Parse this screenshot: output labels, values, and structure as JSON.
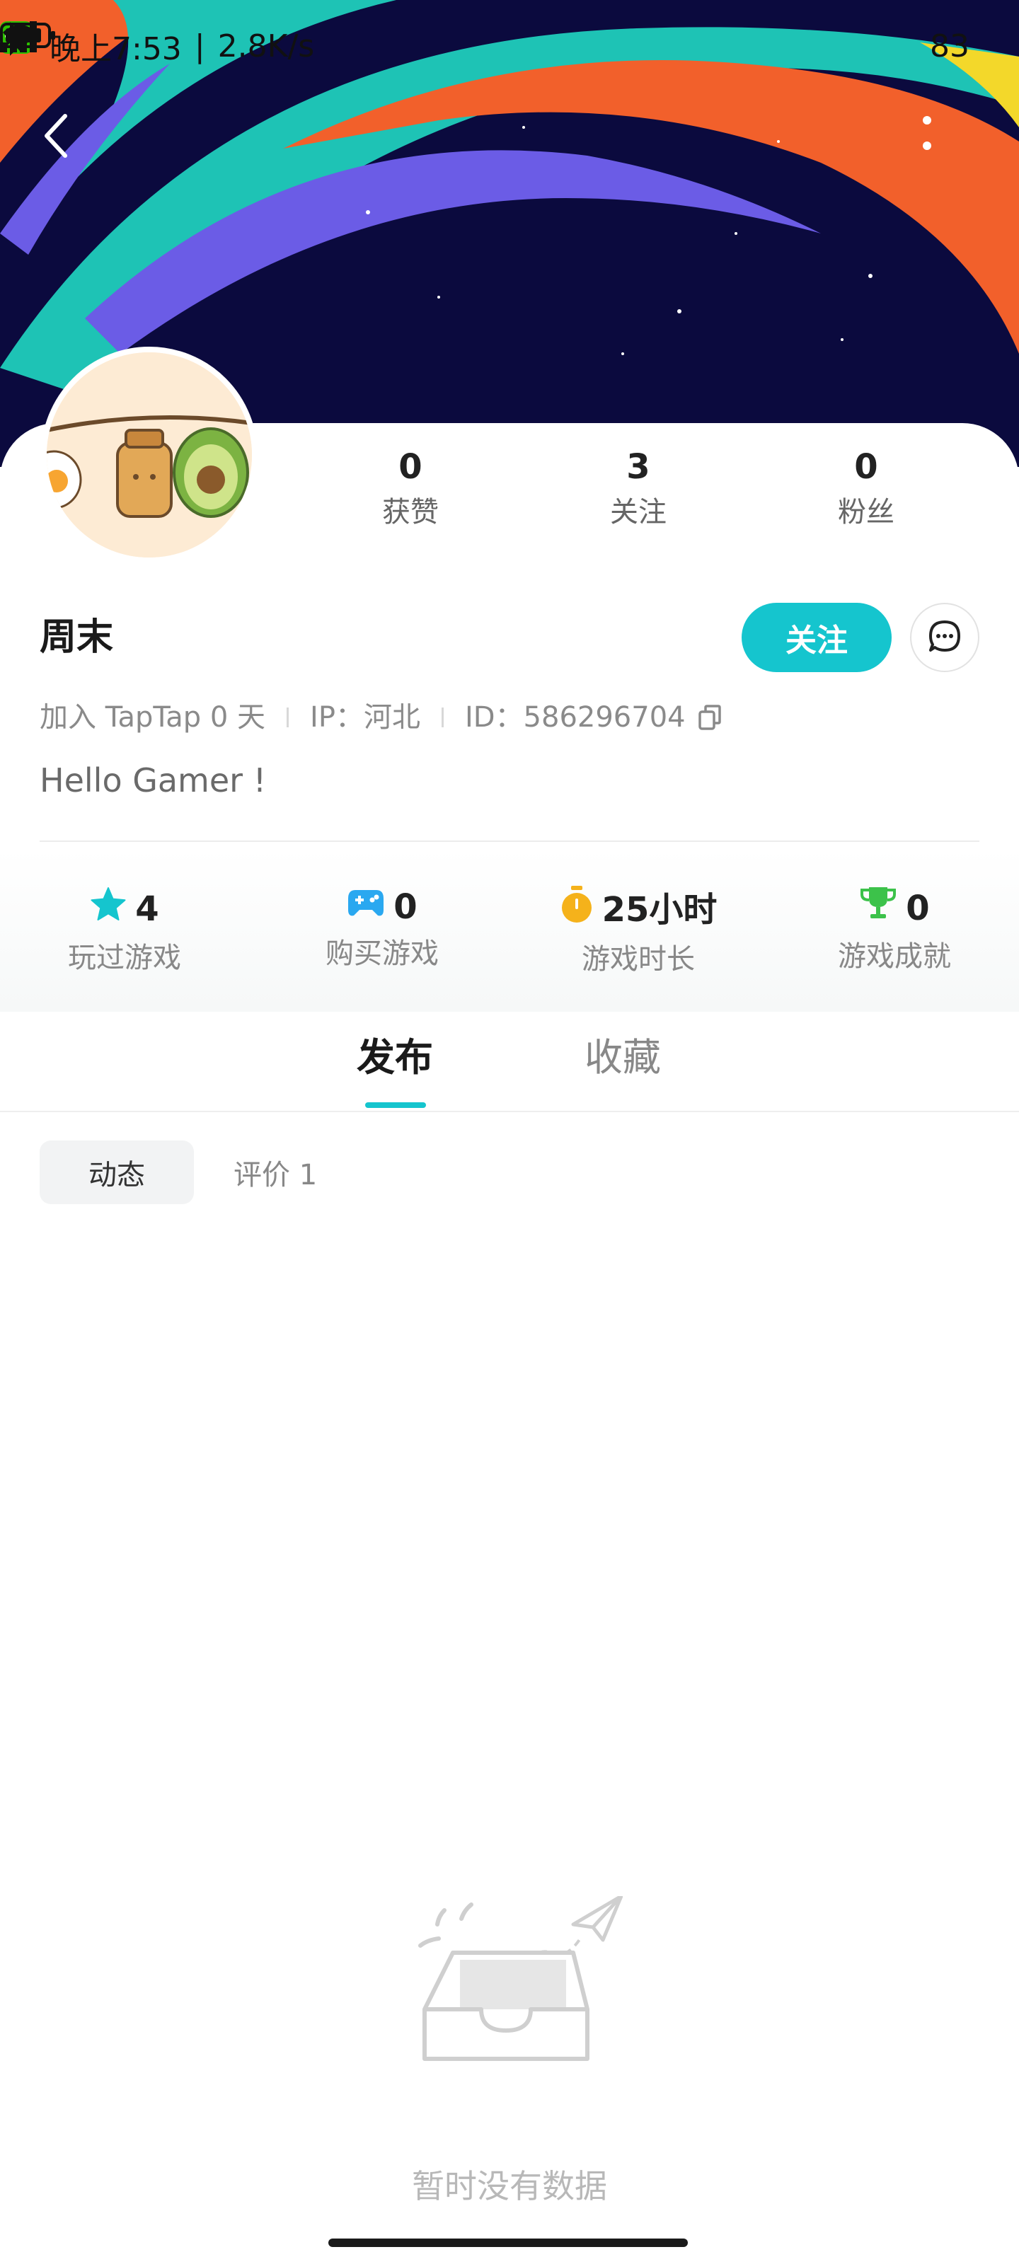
{
  "status_bar": {
    "time": "晚上7:53",
    "speed": "2.8K/s",
    "battery": "83"
  },
  "profile": {
    "name": "周末",
    "stats": [
      {
        "value": "0",
        "label": "获赞"
      },
      {
        "value": "3",
        "label": "关注"
      },
      {
        "value": "0",
        "label": "粉丝"
      }
    ],
    "follow_label": "关注",
    "meta": {
      "joined": "加入 TapTap 0 天",
      "ip": "IP：河北",
      "id": "ID：586296704"
    },
    "bio": "Hello Gamer !"
  },
  "game_stats": [
    {
      "value": "4",
      "label": "玩过游戏",
      "icon": "star-icon",
      "color": "#15c5ce"
    },
    {
      "value": "0",
      "label": "购买游戏",
      "icon": "gamepad-icon",
      "color": "#2aa8f0"
    },
    {
      "value": "25小时",
      "label": "游戏时长",
      "icon": "timer-icon",
      "color": "#f5b21b"
    },
    {
      "value": "0",
      "label": "游戏成就",
      "icon": "trophy-icon",
      "color": "#3cc24a"
    }
  ],
  "tabs": [
    {
      "label": "发布",
      "active": true
    },
    {
      "label": "收藏",
      "active": false
    }
  ],
  "subtabs": [
    {
      "label": "动态",
      "active": true
    },
    {
      "label": "评价 1",
      "active": false
    }
  ],
  "empty_state": {
    "text": "暂时没有数据"
  },
  "colors": {
    "accent": "#15c5ce",
    "banner_bg": "#0b0a3e"
  }
}
